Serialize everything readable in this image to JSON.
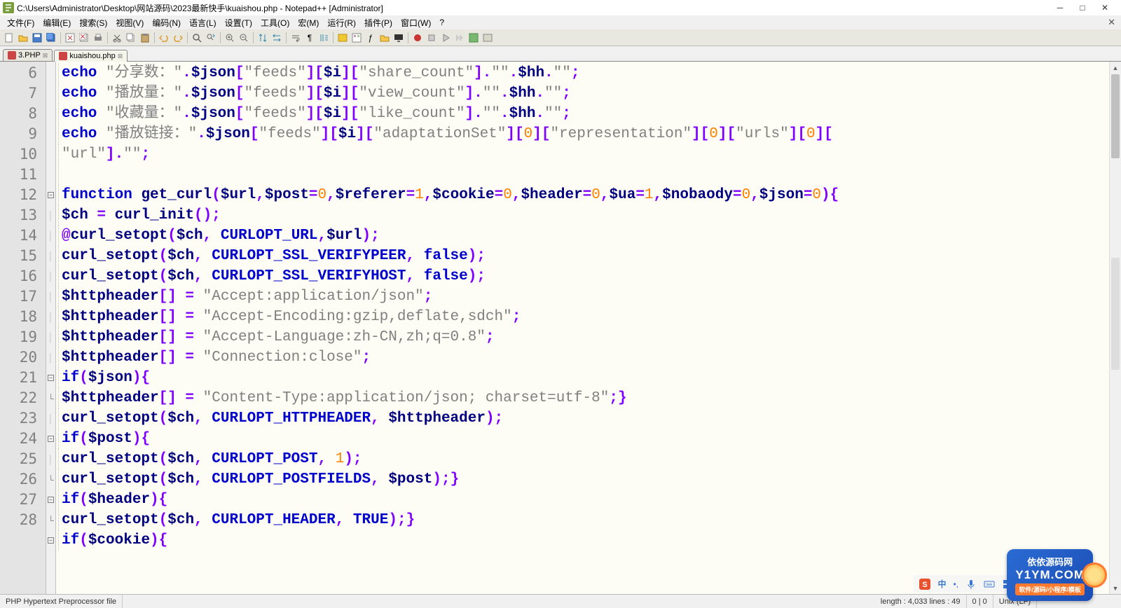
{
  "title": "C:\\Users\\Administrator\\Desktop\\网站源码\\2023最新快手\\kuaishou.php - Notepad++ [Administrator]",
  "menus": [
    "文件(F)",
    "编辑(E)",
    "搜索(S)",
    "视图(V)",
    "编码(N)",
    "语言(L)",
    "设置(T)",
    "工具(O)",
    "宏(M)",
    "运行(R)",
    "插件(P)",
    "窗口(W)",
    "?"
  ],
  "tabs": [
    {
      "label": "3.PHP",
      "active": false,
      "dirty": true
    },
    {
      "label": "kuaishou.php",
      "active": true,
      "dirty": true
    }
  ],
  "lines": {
    "start": 6,
    "count": 23
  },
  "code": [
    {
      "n": 6,
      "t": [
        [
          "kw",
          "echo"
        ],
        [
          "op",
          " "
        ],
        [
          "str",
          "\"分享数：\""
        ],
        [
          "op",
          "."
        ],
        [
          "var",
          "$json"
        ],
        [
          "op",
          "["
        ],
        [
          "str",
          "\"feeds\""
        ],
        [
          "op",
          "]["
        ],
        [
          "var",
          "$i"
        ],
        [
          "op",
          "]["
        ],
        [
          "str",
          "\"share_count\""
        ],
        [
          "op",
          "]."
        ],
        [
          "str",
          "\"\""
        ],
        [
          "op",
          "."
        ],
        [
          "var",
          "$hh"
        ],
        [
          "op",
          "."
        ],
        [
          "str",
          "\"\""
        ],
        [
          "op",
          ";"
        ]
      ]
    },
    {
      "n": 7,
      "t": [
        [
          "kw",
          "echo"
        ],
        [
          "op",
          " "
        ],
        [
          "str",
          "\"播放量：\""
        ],
        [
          "op",
          "."
        ],
        [
          "var",
          "$json"
        ],
        [
          "op",
          "["
        ],
        [
          "str",
          "\"feeds\""
        ],
        [
          "op",
          "]["
        ],
        [
          "var",
          "$i"
        ],
        [
          "op",
          "]["
        ],
        [
          "str",
          "\"view_count\""
        ],
        [
          "op",
          "]."
        ],
        [
          "str",
          "\"\""
        ],
        [
          "op",
          "."
        ],
        [
          "var",
          "$hh"
        ],
        [
          "op",
          "."
        ],
        [
          "str",
          "\"\""
        ],
        [
          "op",
          ";"
        ]
      ]
    },
    {
      "n": 8,
      "t": [
        [
          "kw",
          "echo"
        ],
        [
          "op",
          " "
        ],
        [
          "str",
          "\"收藏量：\""
        ],
        [
          "op",
          "."
        ],
        [
          "var",
          "$json"
        ],
        [
          "op",
          "["
        ],
        [
          "str",
          "\"feeds\""
        ],
        [
          "op",
          "]["
        ],
        [
          "var",
          "$i"
        ],
        [
          "op",
          "]["
        ],
        [
          "str",
          "\"like_count\""
        ],
        [
          "op",
          "]."
        ],
        [
          "str",
          "\"\""
        ],
        [
          "op",
          "."
        ],
        [
          "var",
          "$hh"
        ],
        [
          "op",
          "."
        ],
        [
          "str",
          "\"\""
        ],
        [
          "op",
          ";"
        ]
      ]
    },
    {
      "n": 9,
      "t": [
        [
          "kw",
          "echo"
        ],
        [
          "op",
          " "
        ],
        [
          "str",
          "\"播放链接：\""
        ],
        [
          "op",
          "."
        ],
        [
          "var",
          "$json"
        ],
        [
          "op",
          "["
        ],
        [
          "str",
          "\"feeds\""
        ],
        [
          "op",
          "]["
        ],
        [
          "var",
          "$i"
        ],
        [
          "op",
          "]["
        ],
        [
          "str",
          "\"adaptationSet\""
        ],
        [
          "op",
          "]["
        ],
        [
          "num",
          "0"
        ],
        [
          "op",
          "]["
        ],
        [
          "str",
          "\"representation\""
        ],
        [
          "op",
          "]["
        ],
        [
          "num",
          "0"
        ],
        [
          "op",
          "]["
        ],
        [
          "str",
          "\"urls\""
        ],
        [
          "op",
          "]["
        ],
        [
          "num",
          "0"
        ],
        [
          "op",
          "]["
        ]
      ]
    },
    {
      "n": "",
      "t": [
        [
          "str",
          "\"url\""
        ],
        [
          "op",
          "]."
        ],
        [
          "str",
          "\"\""
        ],
        [
          "op",
          ";"
        ]
      ],
      "wrap": true
    },
    {
      "n": 10,
      "t": []
    },
    {
      "n": 11,
      "fold": "open",
      "t": [
        [
          "kw",
          "function"
        ],
        [
          "op",
          " "
        ],
        [
          "fn",
          "get_curl"
        ],
        [
          "op",
          "("
        ],
        [
          "var",
          "$url"
        ],
        [
          "op",
          ","
        ],
        [
          "var",
          "$post"
        ],
        [
          "op",
          "="
        ],
        [
          "num",
          "0"
        ],
        [
          "op",
          ","
        ],
        [
          "var",
          "$referer"
        ],
        [
          "op",
          "="
        ],
        [
          "num",
          "1"
        ],
        [
          "op",
          ","
        ],
        [
          "var",
          "$cookie"
        ],
        [
          "op",
          "="
        ],
        [
          "num",
          "0"
        ],
        [
          "op",
          ","
        ],
        [
          "var",
          "$header"
        ],
        [
          "op",
          "="
        ],
        [
          "num",
          "0"
        ],
        [
          "op",
          ","
        ],
        [
          "var",
          "$ua"
        ],
        [
          "op",
          "="
        ],
        [
          "num",
          "1"
        ],
        [
          "op",
          ","
        ],
        [
          "var",
          "$nobaody"
        ],
        [
          "op",
          "="
        ],
        [
          "num",
          "0"
        ],
        [
          "op",
          ","
        ],
        [
          "var",
          "$json"
        ],
        [
          "op",
          "="
        ],
        [
          "num",
          "0"
        ],
        [
          "op",
          ")"
        ],
        [
          "brace",
          "{"
        ]
      ]
    },
    {
      "n": 12,
      "t": [
        [
          "var",
          "$ch"
        ],
        [
          "op",
          " = "
        ],
        [
          "fn",
          "curl_init"
        ],
        [
          "op",
          "();"
        ]
      ]
    },
    {
      "n": 13,
      "t": [
        [
          "op",
          "@"
        ],
        [
          "fn",
          "curl_setopt"
        ],
        [
          "op",
          "("
        ],
        [
          "var",
          "$ch"
        ],
        [
          "op",
          ", "
        ],
        [
          "const",
          "CURLOPT_URL"
        ],
        [
          "op",
          ","
        ],
        [
          "var",
          "$url"
        ],
        [
          "op",
          ");"
        ]
      ]
    },
    {
      "n": 14,
      "t": [
        [
          "fn",
          "curl_setopt"
        ],
        [
          "op",
          "("
        ],
        [
          "var",
          "$ch"
        ],
        [
          "op",
          ", "
        ],
        [
          "const",
          "CURLOPT_SSL_VERIFYPEER"
        ],
        [
          "op",
          ", "
        ],
        [
          "kw",
          "false"
        ],
        [
          "op",
          ");"
        ]
      ]
    },
    {
      "n": 15,
      "t": [
        [
          "fn",
          "curl_setopt"
        ],
        [
          "op",
          "("
        ],
        [
          "var",
          "$ch"
        ],
        [
          "op",
          ", "
        ],
        [
          "const",
          "CURLOPT_SSL_VERIFYHOST"
        ],
        [
          "op",
          ", "
        ],
        [
          "kw",
          "false"
        ],
        [
          "op",
          ");"
        ]
      ]
    },
    {
      "n": 16,
      "t": [
        [
          "var",
          "$httpheader"
        ],
        [
          "op",
          "[] = "
        ],
        [
          "str",
          "\"Accept:application/json\""
        ],
        [
          "op",
          ";"
        ]
      ]
    },
    {
      "n": 17,
      "t": [
        [
          "var",
          "$httpheader"
        ],
        [
          "op",
          "[] = "
        ],
        [
          "str",
          "\"Accept-Encoding:gzip,deflate,sdch\""
        ],
        [
          "op",
          ";"
        ]
      ]
    },
    {
      "n": 18,
      "t": [
        [
          "var",
          "$httpheader"
        ],
        [
          "op",
          "[] = "
        ],
        [
          "str",
          "\"Accept-Language:zh-CN,zh;q=0.8\""
        ],
        [
          "op",
          ";"
        ]
      ]
    },
    {
      "n": 19,
      "t": [
        [
          "var",
          "$httpheader"
        ],
        [
          "op",
          "[] = "
        ],
        [
          "str",
          "\"Connection:close\""
        ],
        [
          "op",
          ";"
        ]
      ]
    },
    {
      "n": 20,
      "fold": "open",
      "t": [
        [
          "kw",
          "if"
        ],
        [
          "op",
          "("
        ],
        [
          "var",
          "$json"
        ],
        [
          "op",
          ")"
        ],
        [
          "brace",
          "{"
        ]
      ]
    },
    {
      "n": 21,
      "fold": "end",
      "t": [
        [
          "var",
          "$httpheader"
        ],
        [
          "op",
          "[] = "
        ],
        [
          "str",
          "\"Content-Type:application/json; charset=utf-8\""
        ],
        [
          "op",
          ";"
        ],
        [
          "brace",
          "}"
        ]
      ]
    },
    {
      "n": 22,
      "t": [
        [
          "fn",
          "curl_setopt"
        ],
        [
          "op",
          "("
        ],
        [
          "var",
          "$ch"
        ],
        [
          "op",
          ", "
        ],
        [
          "const",
          "CURLOPT_HTTPHEADER"
        ],
        [
          "op",
          ", "
        ],
        [
          "var",
          "$httpheader"
        ],
        [
          "op",
          ");"
        ]
      ]
    },
    {
      "n": 23,
      "fold": "open",
      "t": [
        [
          "kw",
          "if"
        ],
        [
          "op",
          "("
        ],
        [
          "var",
          "$post"
        ],
        [
          "op",
          ")"
        ],
        [
          "brace",
          "{"
        ]
      ]
    },
    {
      "n": 24,
      "t": [
        [
          "fn",
          "curl_setopt"
        ],
        [
          "op",
          "("
        ],
        [
          "var",
          "$ch"
        ],
        [
          "op",
          ", "
        ],
        [
          "const",
          "CURLOPT_POST"
        ],
        [
          "op",
          ", "
        ],
        [
          "num",
          "1"
        ],
        [
          "op",
          ");"
        ]
      ]
    },
    {
      "n": 25,
      "fold": "end",
      "t": [
        [
          "fn",
          "curl_setopt"
        ],
        [
          "op",
          "("
        ],
        [
          "var",
          "$ch"
        ],
        [
          "op",
          ", "
        ],
        [
          "const",
          "CURLOPT_POSTFIELDS"
        ],
        [
          "op",
          ", "
        ],
        [
          "var",
          "$post"
        ],
        [
          "op",
          ");"
        ],
        [
          "brace",
          "}"
        ]
      ]
    },
    {
      "n": 26,
      "fold": "open",
      "t": [
        [
          "kw",
          "if"
        ],
        [
          "op",
          "("
        ],
        [
          "var",
          "$header"
        ],
        [
          "op",
          ")"
        ],
        [
          "brace",
          "{"
        ]
      ]
    },
    {
      "n": 27,
      "fold": "end",
      "t": [
        [
          "fn",
          "curl_setopt"
        ],
        [
          "op",
          "("
        ],
        [
          "var",
          "$ch"
        ],
        [
          "op",
          ", "
        ],
        [
          "const",
          "CURLOPT_HEADER"
        ],
        [
          "op",
          ", "
        ],
        [
          "kw",
          "TRUE"
        ],
        [
          "op",
          ");"
        ],
        [
          "brace",
          "}"
        ]
      ]
    },
    {
      "n": 28,
      "fold": "open",
      "t": [
        [
          "kw",
          "if"
        ],
        [
          "op",
          "("
        ],
        [
          "var",
          "$cookie"
        ],
        [
          "op",
          ")"
        ],
        [
          "brace",
          "{"
        ]
      ]
    }
  ],
  "status": {
    "filetype": "PHP Hypertext Preprocessor file",
    "length": "length : 4,033    lines : 49",
    "pos": "0 | 0",
    "eol": "Unix (LF)"
  },
  "logo": {
    "main": "依依源码网",
    "url": "Y1YM.COM",
    "sub": "软件/源码/小程序/模板"
  },
  "ime": {
    "letter": "S",
    "lang": "中"
  }
}
